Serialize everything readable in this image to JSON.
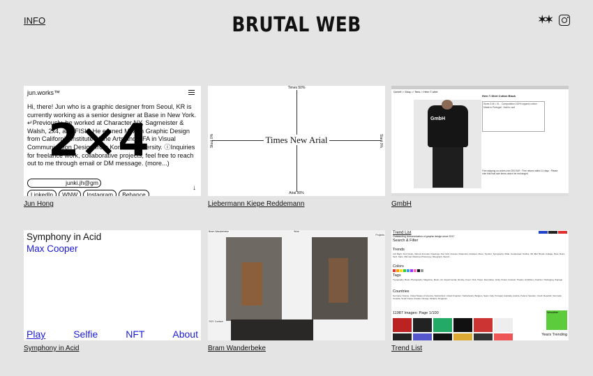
{
  "header": {
    "info_label": "INFO",
    "title": "BRUTAL WEB",
    "star_icon": "✶✶",
    "instagram_icon": "instagram-icon"
  },
  "cards": [
    {
      "caption": "Jun Hong",
      "thumb": {
        "site_name": "jun.works™",
        "body": "Hi, there! Jun who is a graphic designer from Seoul, KR is currently working as a senior designer at Base in New York. ↵Previously, he worked at Character NY, Sagmeister & Walsh, 2x4, and FISK. He earned MFA in Graphic Design from California Institute of the Arts and BFA in Visual Communication Design from Konkuk University. ⓘInquiries for freelance work, collaborative projects, feel free to reach out to me through email or DM message. (more...)",
        "overlay": "2×4",
        "email": "junki.jh@gm",
        "pills": [
          "LinkedIn",
          "WNW",
          "Instagram",
          "Behance"
        ],
        "arrow": "↓"
      }
    },
    {
      "caption": "Liebermann Kiepe Reddemann",
      "thumb": {
        "center": "Times New Arial",
        "top": "Times 50%",
        "bottom": "Arial 90%",
        "left": "Stout 0%",
        "right": "Slant 0%"
      }
    },
    {
      "caption": "GmbH",
      "thumb": {
        "nav": "GmbH > Shop > Tees > Hem T-shirt",
        "shirt_print": "GmbH",
        "product_title": "Hem T-Shirt Cotton Black",
        "form": "Sizes S M L XL · Composition 100% organic cotton · Made in Portugal · Add to cart",
        "lines": "Free shipping on orders over 200 EUR · Free returns within 14 days · Please note that final sale items cannot be exchanged"
      }
    },
    {
      "caption": "Symphony in Acid",
      "thumb": {
        "title": "Symphony in Acid",
        "artist": "Max Cooper",
        "nav": [
          "Play",
          "Selfie",
          "NFT",
          "About"
        ]
      }
    },
    {
      "caption": "Bram Wanderbeke",
      "thumb": {
        "tag_top_left": "Bram Wanderbeke",
        "tag_top_mid": "Work",
        "tag_top_right": "Projects",
        "tag_bottom": "2021 Contact"
      }
    },
    {
      "caption": "Trend List",
      "thumb": {
        "title": "Trend List",
        "subtitle": "Outstanding documentation of graphic design since 2017",
        "search": "Search & Filter",
        "trends": "Trends",
        "trends_text": "Left Right, Sci-fi Grain, Various Formats, Drawings, Flat, Grid, Frames, Modernist, Gradient, Mono, Symbol, Typography, Wide, Condensed, Outline, 3D, Blur, Brutal, Collage, Pixel, Retro, Serif, Sans, Minimal, Maximal, Photocopy, Risograph, Stencil",
        "colors": "Colors",
        "tags": "Tags",
        "tags_text": "Typography, Book, Photography, Magazine, Music, Art, Experimental, Identity, Cover, Club, Paper, Decorative, Gritty, Poster, Festival, Theatre, Exhibition, Fashion, Packaging, Signage",
        "countries": "Countries",
        "countries_text": "Germany, France, United States of America, Switzerland, United Kingdom, Netherlands, Belgium, Spain, Italy, Portugal, Australia, Austria, Poland, Sweden, Czech Republic, Denmark, Canada, South Korea, Russia, Norway, Finland, Singapore",
        "count": "11987 Images: Page 1/100",
        "newsletter": "Newsletter",
        "years": "Years Trending"
      }
    }
  ],
  "colors": {
    "background": "#e4e4e4",
    "symphony_blue": "#1a1ad6",
    "trend_green": "#5ccc3c"
  }
}
